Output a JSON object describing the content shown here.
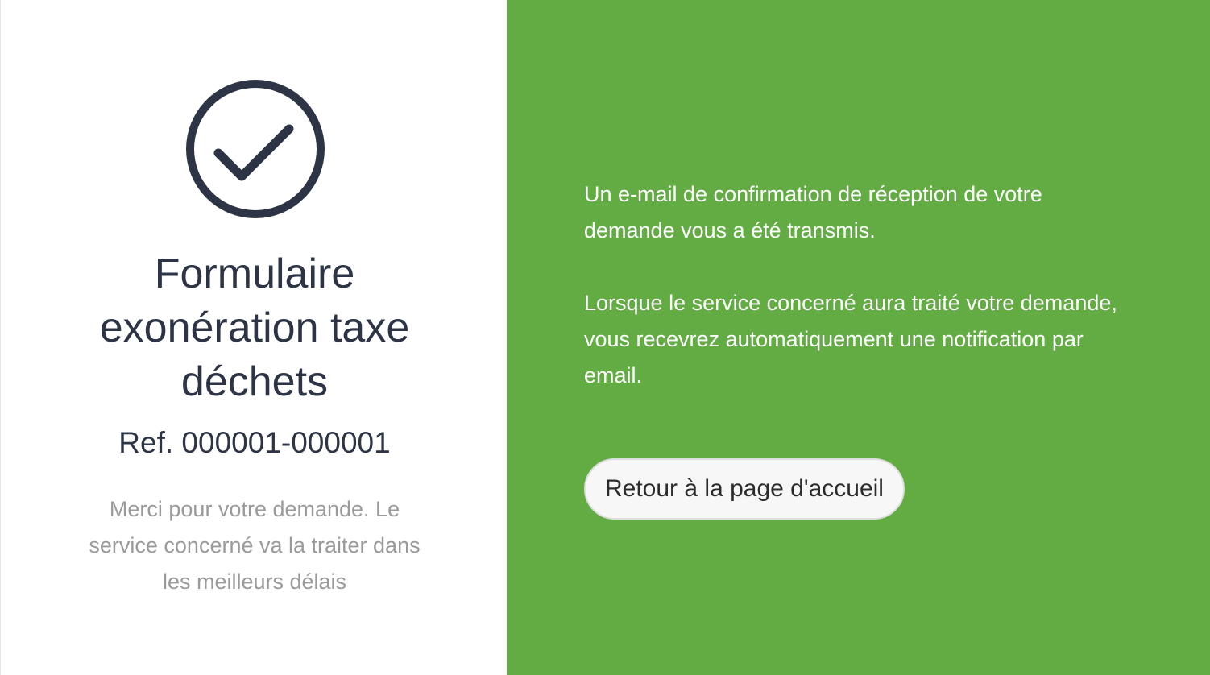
{
  "confirmation": {
    "icon": "check-circle-icon",
    "title": "Formulaire exonération taxe déchets",
    "reference": "Ref. 000001-000001",
    "thanks_message": "Merci pour votre demande. Le service concerné va la traiter dans les meilleurs délais"
  },
  "info": {
    "email_notice": "Un e-mail de confirmation de réception de votre demande vous a été transmis.",
    "processing_notice": "Lorsque le service concerné aura traité votre demande, vous recevrez automatiquement une notification par email.",
    "home_button_label": "Retour à la page d'accueil"
  },
  "colors": {
    "accent_green": "#62ac43",
    "text_dark": "#2c3445",
    "text_muted": "#9a9a9a"
  }
}
